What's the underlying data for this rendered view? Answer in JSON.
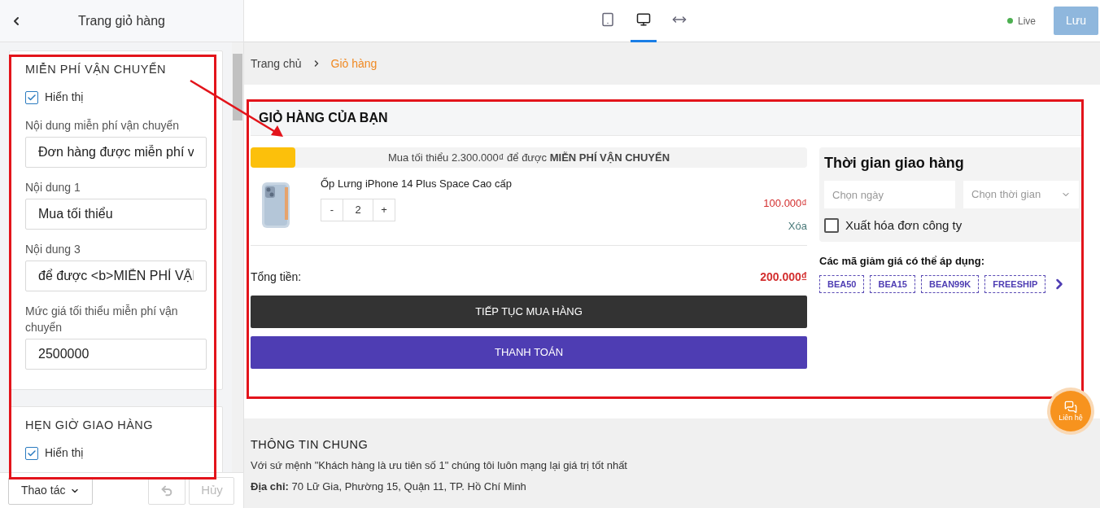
{
  "sidebar": {
    "title": "Trang giỏ hàng",
    "sections": [
      {
        "title": "MIỄN PHÍ VẬN CHUYỂN",
        "fields": [
          {
            "kind": "checkbox",
            "label": "Hiển thị",
            "checked": true
          },
          {
            "kind": "input",
            "label": "Nội dung miễn phí vận chuyển",
            "value": "Đơn hàng được miễn phí v"
          },
          {
            "kind": "input",
            "label": "Nội dung 1",
            "value": "Mua tối thiểu"
          },
          {
            "kind": "input",
            "label": "Nội dung 3",
            "value": "để được <b>MIỄN PHÍ VẬI"
          },
          {
            "kind": "input",
            "label": "Mức giá tối thiểu miễn phí vận chuyển",
            "value": "2500000"
          }
        ]
      },
      {
        "title": "HẸN GIỜ GIAO HÀNG",
        "fields": [
          {
            "kind": "checkbox",
            "label": "Hiển thị",
            "checked": true
          }
        ]
      }
    ],
    "actions_button": "Thao tác",
    "cancel_button": "Hủy"
  },
  "toolbar": {
    "devices": [
      {
        "kind": "tablet",
        "selected": false
      },
      {
        "kind": "desktop",
        "selected": true
      },
      {
        "kind": "fullwidth",
        "selected": false
      }
    ],
    "status": "Live",
    "save_button": "Lưu"
  },
  "breadcrumb": [
    {
      "label": "Trang chủ",
      "selected": false
    },
    {
      "label": "Giỏ hàng",
      "selected": true
    }
  ],
  "cart": {
    "title": "GIỎ HÀNG CỦA BẠN",
    "shipping_bar": {
      "level": 0.08,
      "text": "Mua tối thiểu 2.300.000₫ để được **MIỄN PHÍ VẬN CHUYỂN**"
    },
    "items": [
      {
        "name": "Ốp Lưng iPhone 14 Plus Space Cao cấp",
        "minus": "-",
        "quantity": "2",
        "plus": "+",
        "price": "100.000₫",
        "remove": "Xóa"
      }
    ],
    "total_label": "Tổng tiền:",
    "total": "200.000₫",
    "continue_button": "TIẾP TỤC MUA HÀNG",
    "checkout_button": "THANH TOÁN",
    "delivery": {
      "title": "Thời gian giao hàng",
      "date_placeholder": "Chọn ngày",
      "time_placeholder": "Chọn thời gian",
      "invoice": {
        "label": "Xuất hóa đơn công ty",
        "checked": false
      }
    },
    "coupons_title": "Các mã giảm giá có thể áp dụng:",
    "coupons": [
      "BEA50",
      "BEA15",
      "BEAN99K",
      "FREESHIP"
    ]
  },
  "footer": {
    "title": "THÔNG TIN CHUNG",
    "text": "Với sứ mệnh \"Khách hàng là ưu tiên số 1\" chúng tôi luôn mạng lại giá trị tốt nhất",
    "address": "**Địa chỉ:** 70 Lữ Gia, Phường 15, Quận 11, TP. Hồ Chí Minh"
  },
  "chat_button": "Liên hệ"
}
